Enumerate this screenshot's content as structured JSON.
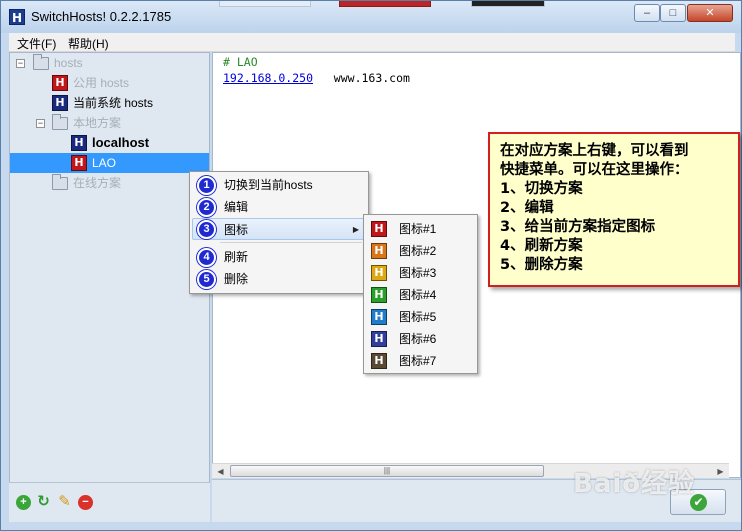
{
  "window": {
    "title": "SwitchHosts! 0.2.2.1785",
    "app_icon_letter": "H",
    "minimize_glyph": "–",
    "maximize_glyph": "□",
    "close_glyph": "✕"
  },
  "menubar": {
    "file_label": "文件(F)",
    "help_label": "帮助(H)"
  },
  "sidebar": {
    "root": {
      "label": "hosts",
      "expander": "−"
    },
    "public_hosts": {
      "label": "公用 hosts",
      "icon": "H",
      "icon_color": "#c0171b"
    },
    "current_hosts": {
      "label": "当前系统 hosts",
      "icon": "H",
      "icon_color": "#1a2a7e"
    },
    "local_group": {
      "label": "本地方案",
      "expander": "−"
    },
    "localhost": {
      "label": "localhost",
      "icon": "H",
      "icon_color": "#1a2a7e"
    },
    "lao": {
      "label": "LAO",
      "icon": "H",
      "icon_color": "#c0171b"
    },
    "online_group": {
      "label": "在线方案"
    }
  },
  "toolbar": {
    "add_icon": "add-icon",
    "add_glyph": "+",
    "refresh_icon": "refresh-icon",
    "refresh_glyph": "↻",
    "edit_icon": "pencil-icon",
    "edit_glyph": "✎",
    "delete_icon": "remove-icon",
    "delete_glyph": "−"
  },
  "editor": {
    "line1": "# LAO",
    "line2_ip": "192.168.0.250",
    "line2_host": "www.163.com"
  },
  "scrollbar": {
    "left_arrow": "◀",
    "right_arrow": "▶",
    "thumb_grip": "|||"
  },
  "ok_button": {
    "glyph": "✔"
  },
  "context_menu": {
    "items": [
      {
        "num": "1",
        "label": "切换到当前hosts"
      },
      {
        "num": "2",
        "label": "编辑"
      },
      {
        "num": "3",
        "label": "图标",
        "arrow": "▶"
      },
      {
        "num": "4",
        "label": "刷新"
      },
      {
        "num": "5",
        "label": "删除"
      }
    ]
  },
  "icon_submenu": {
    "items": [
      {
        "label": "图标#1",
        "color": "#c0171b"
      },
      {
        "label": "图标#2",
        "color": "#d8761a"
      },
      {
        "label": "图标#3",
        "color": "#dca814"
      },
      {
        "label": "图标#4",
        "color": "#2aa02a"
      },
      {
        "label": "图标#5",
        "color": "#1f7dc9"
      },
      {
        "label": "图标#6",
        "color": "#303f9c"
      },
      {
        "label": "图标#7",
        "color": "#5b4a33"
      }
    ],
    "icon_letter": "H"
  },
  "callout": {
    "lines": [
      "在对应方案上右键，可以看到",
      "快捷菜单。可以在这里操作：",
      "1、切换方案",
      "2、编辑",
      "3、给当前方案指定图标",
      "4、刷新方案",
      "5、删除方案"
    ]
  },
  "watermark": {
    "text": "Baið经验"
  }
}
